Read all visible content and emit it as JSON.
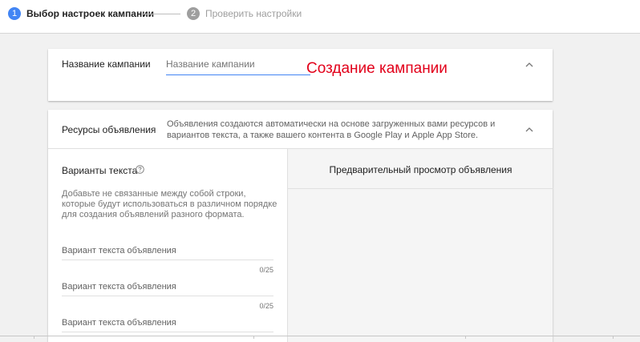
{
  "stepper": {
    "step1": {
      "number": "1",
      "label": "Выбор настроек кампании"
    },
    "step2": {
      "number": "2",
      "label": "Проверить настройки"
    }
  },
  "campaign_name": {
    "label": "Название кампании",
    "placeholder": "Название кампании",
    "value": ""
  },
  "overlay_title": "Создание кампании",
  "ad_resources": {
    "label": "Ресурсы объявления",
    "description": "Объявления создаются автоматически на основе загруженных вами ресурсов и вариантов текста, а также вашего контента в Google Play и Apple App Store."
  },
  "text_variants": {
    "title": "Варианты текста",
    "help": "Добавьте не связанные между собой строки, которые будут использоваться в различном порядке для создания объявлений разного формата.",
    "fields": [
      {
        "placeholder": "Вариант текста объявления",
        "value": "",
        "counter": "0/25"
      },
      {
        "placeholder": "Вариант текста объявления",
        "value": "",
        "counter": "0/25"
      },
      {
        "placeholder": "Вариант текста объявления",
        "value": ""
      }
    ]
  },
  "preview": {
    "title": "Предварительный просмотр объявления"
  },
  "icons": {
    "collapse": "chevron-up-icon",
    "help": "help-circle-icon"
  },
  "colors": {
    "accent": "#4285f4",
    "overlay_text": "#e2001a",
    "inactive_step": "#9e9e9e",
    "background": "#f1f1f1"
  }
}
